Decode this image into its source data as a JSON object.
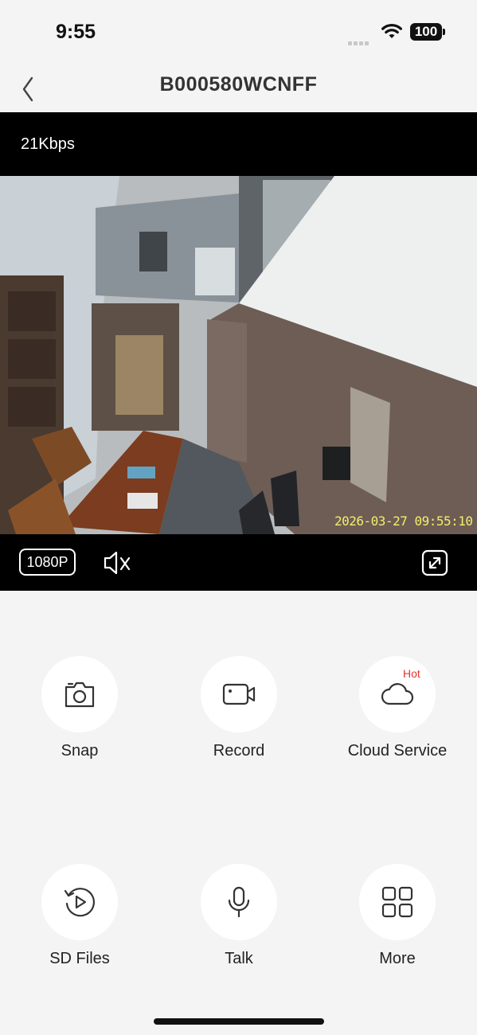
{
  "status_bar": {
    "time": "9:55",
    "battery": "100"
  },
  "nav": {
    "title": "B000580WCNFF"
  },
  "player": {
    "bitrate": "21Kbps",
    "osd_timestamp": "2026-03-27 09:55:10",
    "resolution": "1080P"
  },
  "actions": [
    {
      "label": "Snap",
      "icon": "camera-icon"
    },
    {
      "label": "Record",
      "icon": "video-camera-icon"
    },
    {
      "label": "Cloud Service",
      "icon": "cloud-icon",
      "badge": "Hot"
    },
    {
      "label": "SD Files",
      "icon": "replay-icon"
    },
    {
      "label": "Talk",
      "icon": "microphone-icon"
    },
    {
      "label": "More",
      "icon": "grid-icon"
    }
  ],
  "colors": {
    "badge": "#e5322d",
    "osd_text": "#f3ee6a",
    "background": "#f4f4f4"
  }
}
